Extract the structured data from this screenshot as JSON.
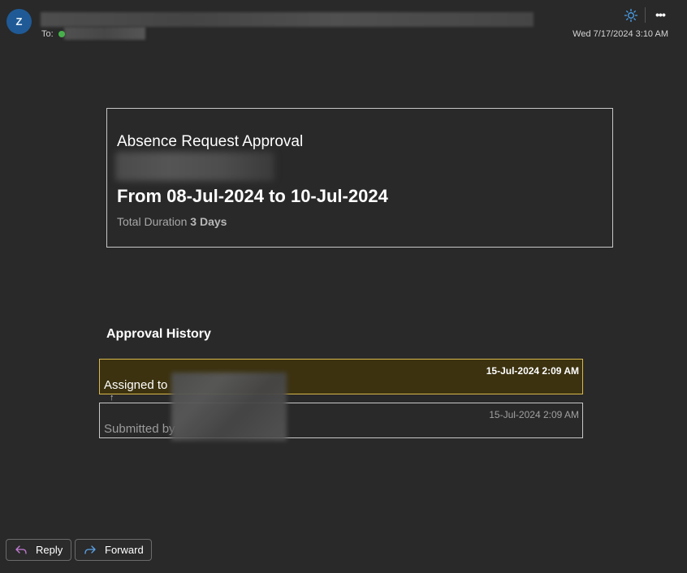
{
  "header": {
    "avatar_initial": "Z",
    "to_label": "To:",
    "date": "Wed 7/17/2024 3:10 AM",
    "icons": {
      "theme": "sun-icon",
      "more": "more-options-icon"
    },
    "more_glyph": "•••"
  },
  "card": {
    "title": "Absence Request Approval",
    "date_range": "From 08-Jul-2024 to 10-Jul-2024",
    "duration_label": "Total Duration",
    "duration_value": "3 Days"
  },
  "history": {
    "heading": "Approval History",
    "arrow": "↑",
    "items": [
      {
        "time": "15-Jul-2024 2:09 AM",
        "label": "Assigned to"
      },
      {
        "time": "15-Jul-2024 2:09 AM",
        "label": "Submitted by"
      }
    ]
  },
  "actions": {
    "reply_label": "Reply",
    "forward_label": "Forward"
  },
  "colors": {
    "background": "#292929",
    "accent_avatar": "#1f5a96",
    "presence": "#47b04b",
    "highlight_bg": "#3c3210",
    "highlight_border": "#d8b84b",
    "reply_icon": "#c27bd6",
    "forward_icon": "#5aa3ea"
  }
}
